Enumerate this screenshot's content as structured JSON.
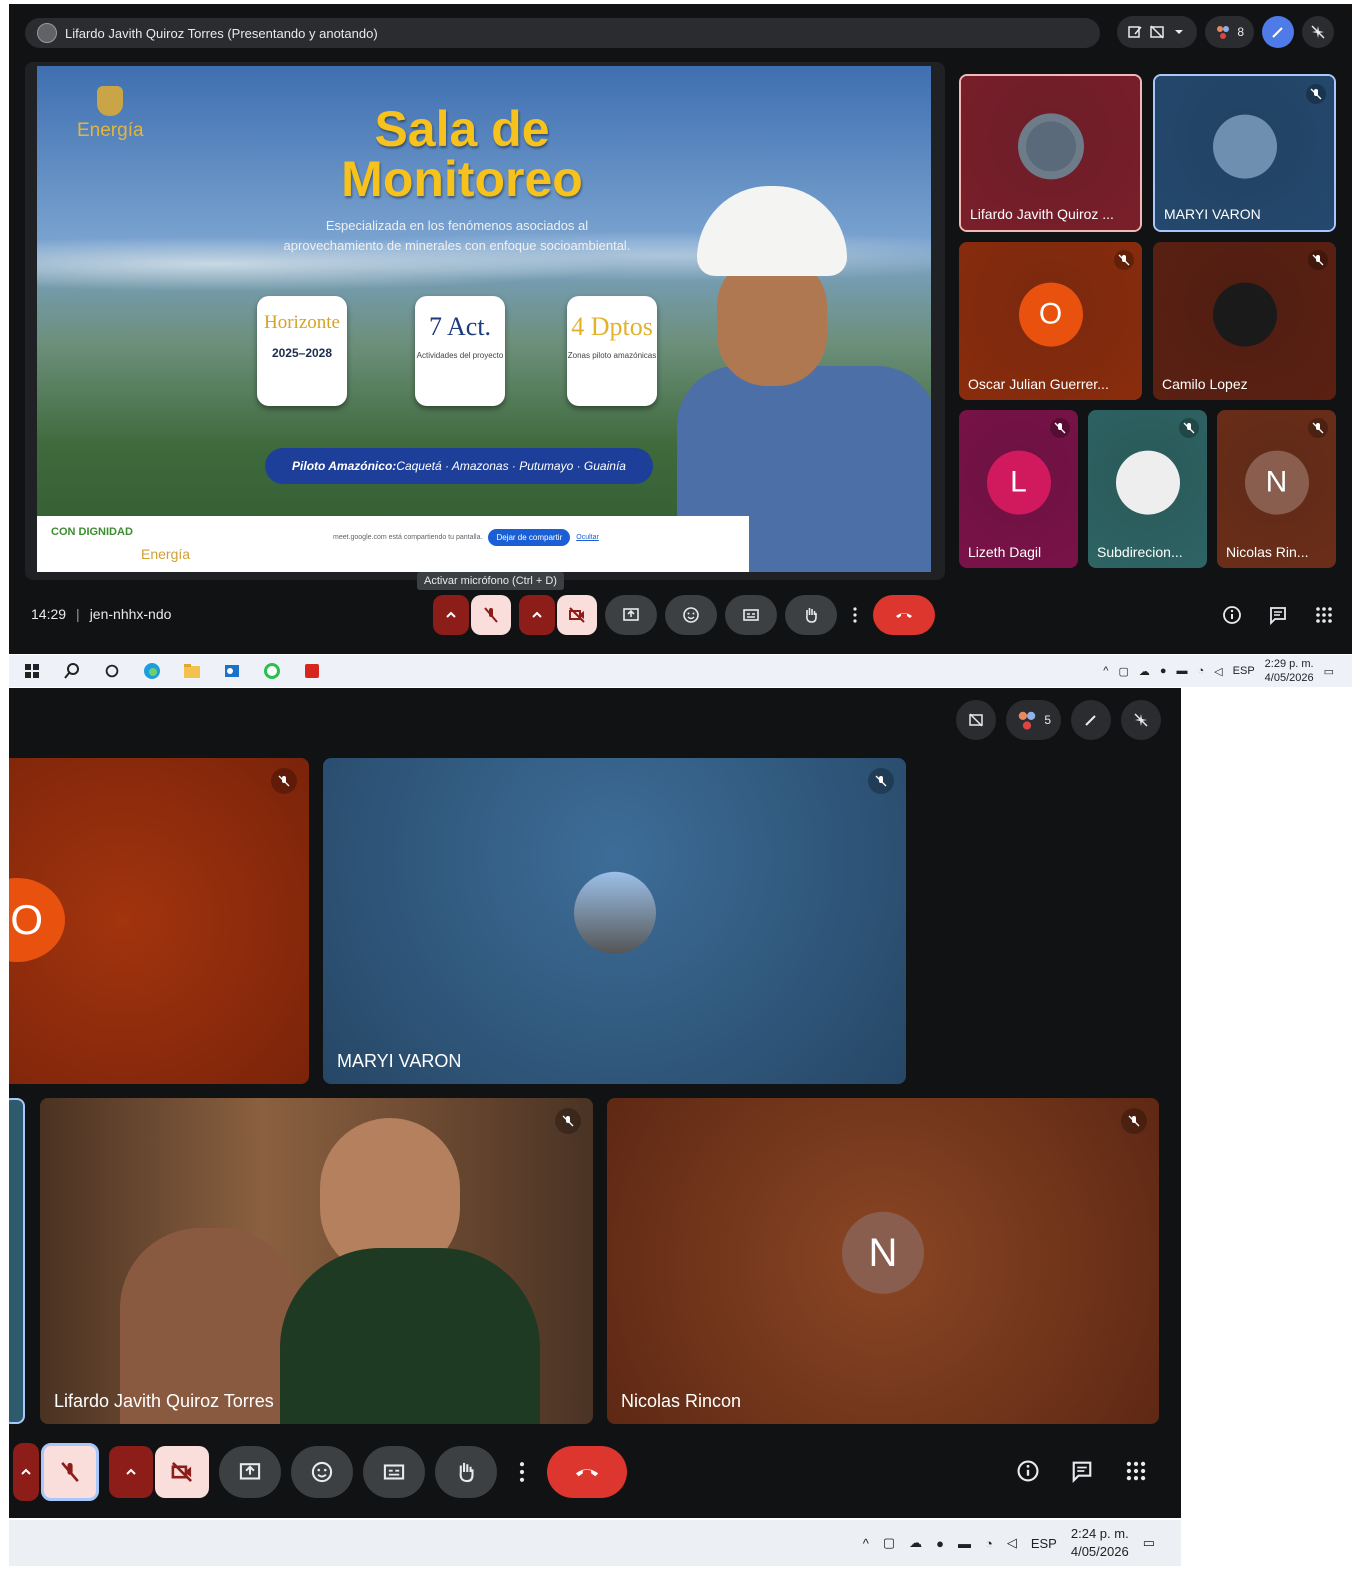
{
  "top": {
    "presenter_label": "Lifardo Javith Quiroz Torres (Presentando y anotando)",
    "participants_count": "8",
    "slide": {
      "logo_text": "Energía",
      "title_line1": "Sala de",
      "title_line2": "Monitoreo",
      "subtitle_line1": "Especializada en los fenómenos asociados al",
      "subtitle_line2": "aprovechamiento de minerales con enfoque socioambiental.",
      "cards": [
        {
          "big": "Horizonte",
          "small": "2025–2028"
        },
        {
          "big": "7 Act.",
          "small": "Actividades del proyecto"
        },
        {
          "big": "4 Dptos",
          "small": "Zonas piloto amazónicas"
        }
      ],
      "piloto_bold": "Piloto Amazónico:",
      "piloto_rest": " Caquetá · Amazonas · Putumayo · Guainía",
      "footer_logo1": "CON DIGNIDAD",
      "footer_logo2": "Energía",
      "share_text": "meet.google.com está compartiendo tu pantalla.",
      "share_stop": "Dejar de compartir",
      "share_hide": "Ocultar"
    },
    "tiles": [
      {
        "name": "Lifardo Javith Quiroz ...",
        "color": "#7a1f2b"
      },
      {
        "name": "MARYI VARON",
        "color": "#24496e"
      },
      {
        "name": "Oscar Julian Guerrer...",
        "letter": "O",
        "color": "#8a2c0d"
      },
      {
        "name": "Camilo Lopez",
        "color": "#5a2012"
      },
      {
        "name": "Lizeth Dagil",
        "letter": "L",
        "color": "#7a1248"
      },
      {
        "name": "Subdirecion...",
        "color": "#2e6464"
      },
      {
        "name": "Nicolas Rin...",
        "letter": "N",
        "color": "#6b2e18"
      }
    ],
    "tooltip": "Activar micrófono (Ctrl + D)",
    "time": "14:29",
    "meeting_code": "jen-nhhx-ndo"
  },
  "taskbar1": {
    "lang": "ESP",
    "time": "2:29 p. m.",
    "date": "4/05/2026"
  },
  "bottom": {
    "participants_count": "5",
    "tiles": [
      {
        "letter": "O",
        "color": "#8f2a0c"
      },
      {
        "name": "MARYI VARON",
        "color": "#2f5a84"
      },
      {
        "name": "Lifardo Javith Quiroz Torres",
        "color": "#6b4a38"
      },
      {
        "name": "Nicolas Rincon",
        "letter": "N",
        "color": "#6b3018"
      }
    ]
  },
  "taskbar2": {
    "lang": "ESP",
    "time": "2:24 p. m.",
    "date": "4/05/2026"
  }
}
